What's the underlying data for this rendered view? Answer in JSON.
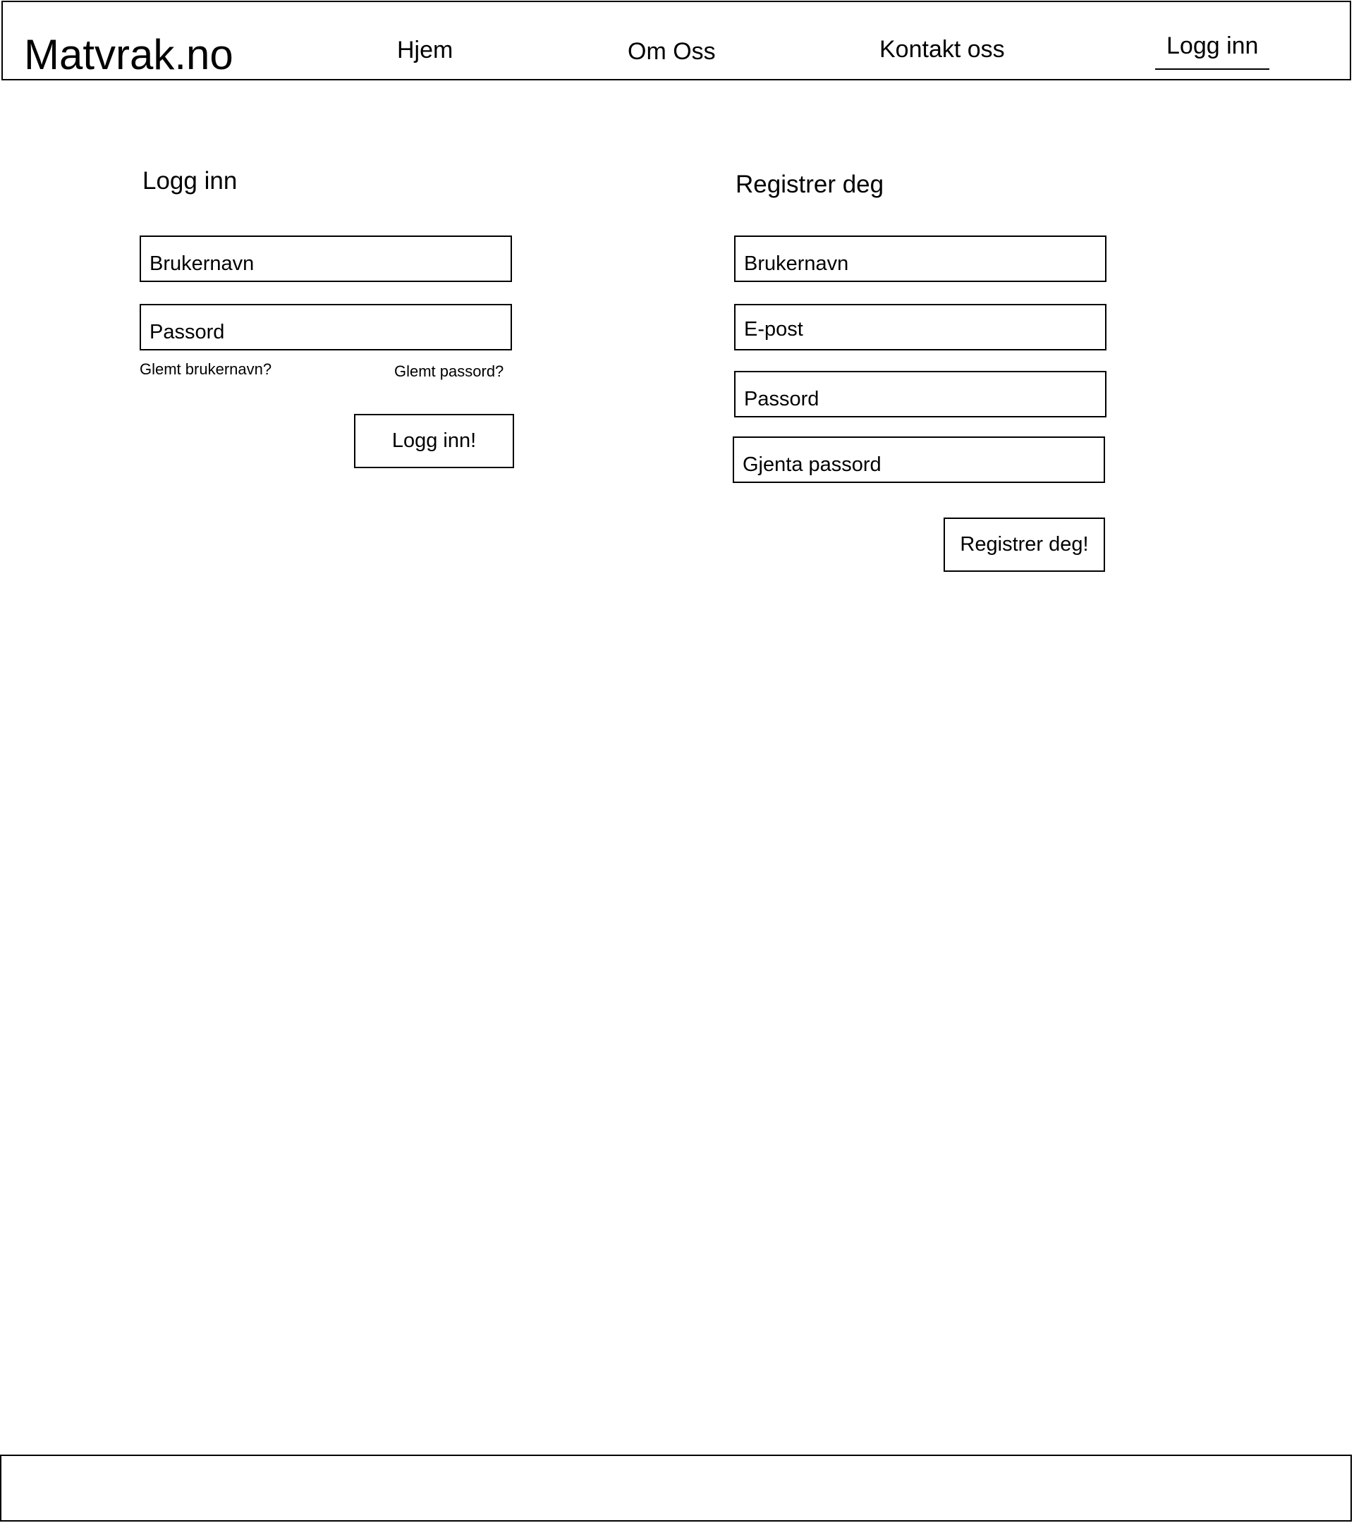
{
  "header": {
    "logo": "Matvrak.no",
    "nav": {
      "home": "Hjem",
      "about": "Om Oss",
      "contact": "Kontakt oss",
      "login": "Logg inn"
    }
  },
  "login": {
    "title": "Logg inn",
    "username_placeholder": "Brukernavn",
    "password_placeholder": "Passord",
    "forgot_username": "Glemt brukernavn?",
    "forgot_password": "Glemt passord?",
    "submit_label": "Logg inn!"
  },
  "register": {
    "title": "Registrer deg",
    "username_placeholder": "Brukernavn",
    "email_placeholder": "E-post",
    "password_placeholder": "Passord",
    "repeat_password_placeholder": "Gjenta passord",
    "submit_label": "Registrer deg!"
  }
}
